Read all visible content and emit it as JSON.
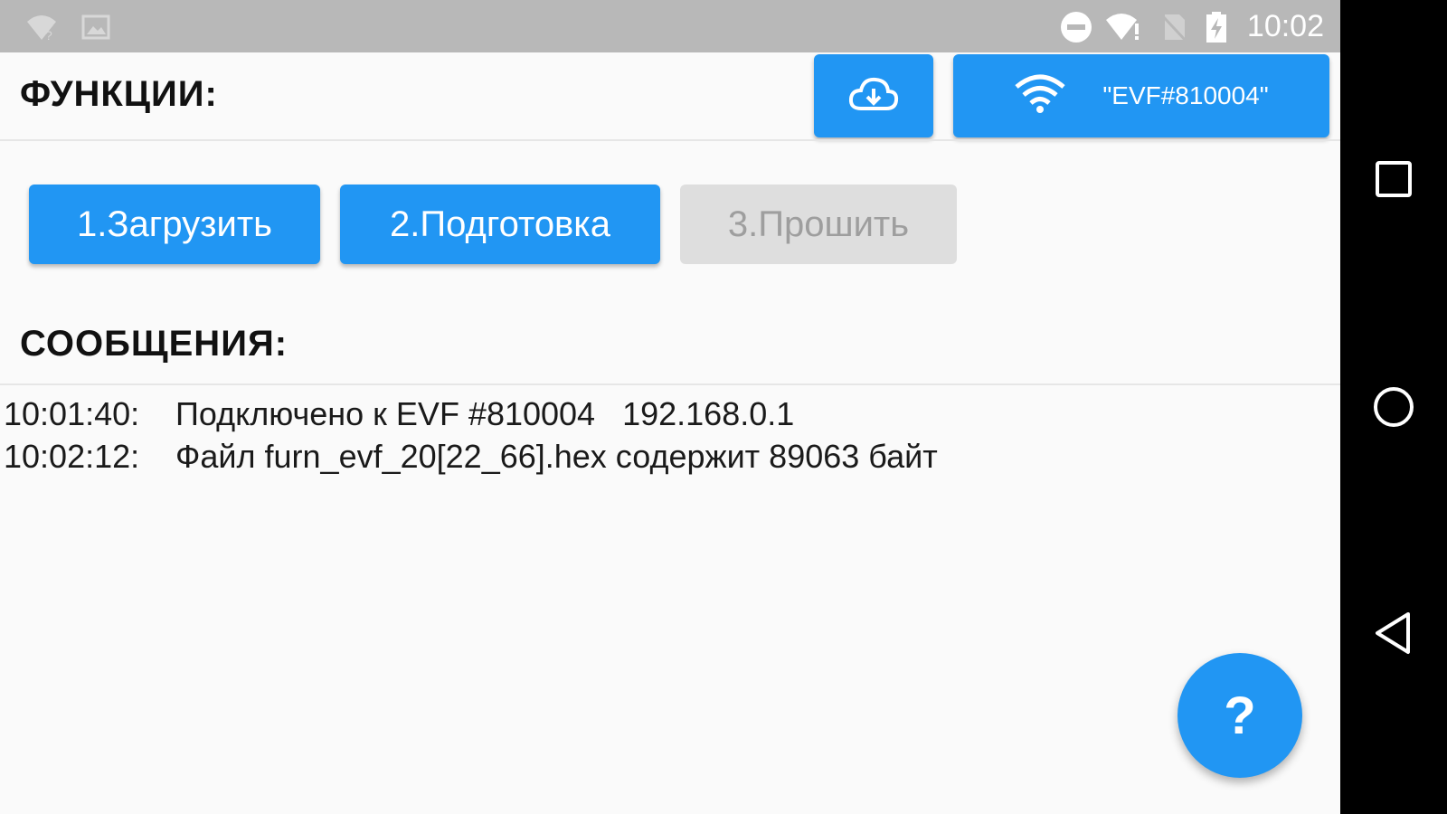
{
  "status_bar": {
    "time": "10:02",
    "icons": [
      "wifi-unknown-icon",
      "image-icon",
      "do-not-disturb-icon",
      "wifi-alert-icon",
      "no-sim-icon",
      "battery-charging-icon"
    ]
  },
  "header": {
    "functions_title": "ФУНКЦИИ:",
    "download_icon": "cloud-download-icon",
    "wifi_icon": "wifi-icon",
    "wifi_network": "\"EVF#810004\""
  },
  "actions": {
    "load_label": "1.Загрузить",
    "prepare_label": "2.Подготовка",
    "flash_label": "3.Прошить"
  },
  "messages": {
    "title": "СООБЩЕНИЯ:",
    "rows": [
      {
        "time": "10:01:40:",
        "text": "Подключено к EVF #810004   192.168.0.1"
      },
      {
        "time": "10:02:12:",
        "text": "Файл furn_evf_20[22_66].hex содержит 89063 байт"
      }
    ]
  },
  "fab": {
    "label": "?"
  },
  "colors": {
    "accent": "#2196f3",
    "disabled": "#dedede",
    "status_bar": "#b8b8b8",
    "background": "#fafafa"
  }
}
